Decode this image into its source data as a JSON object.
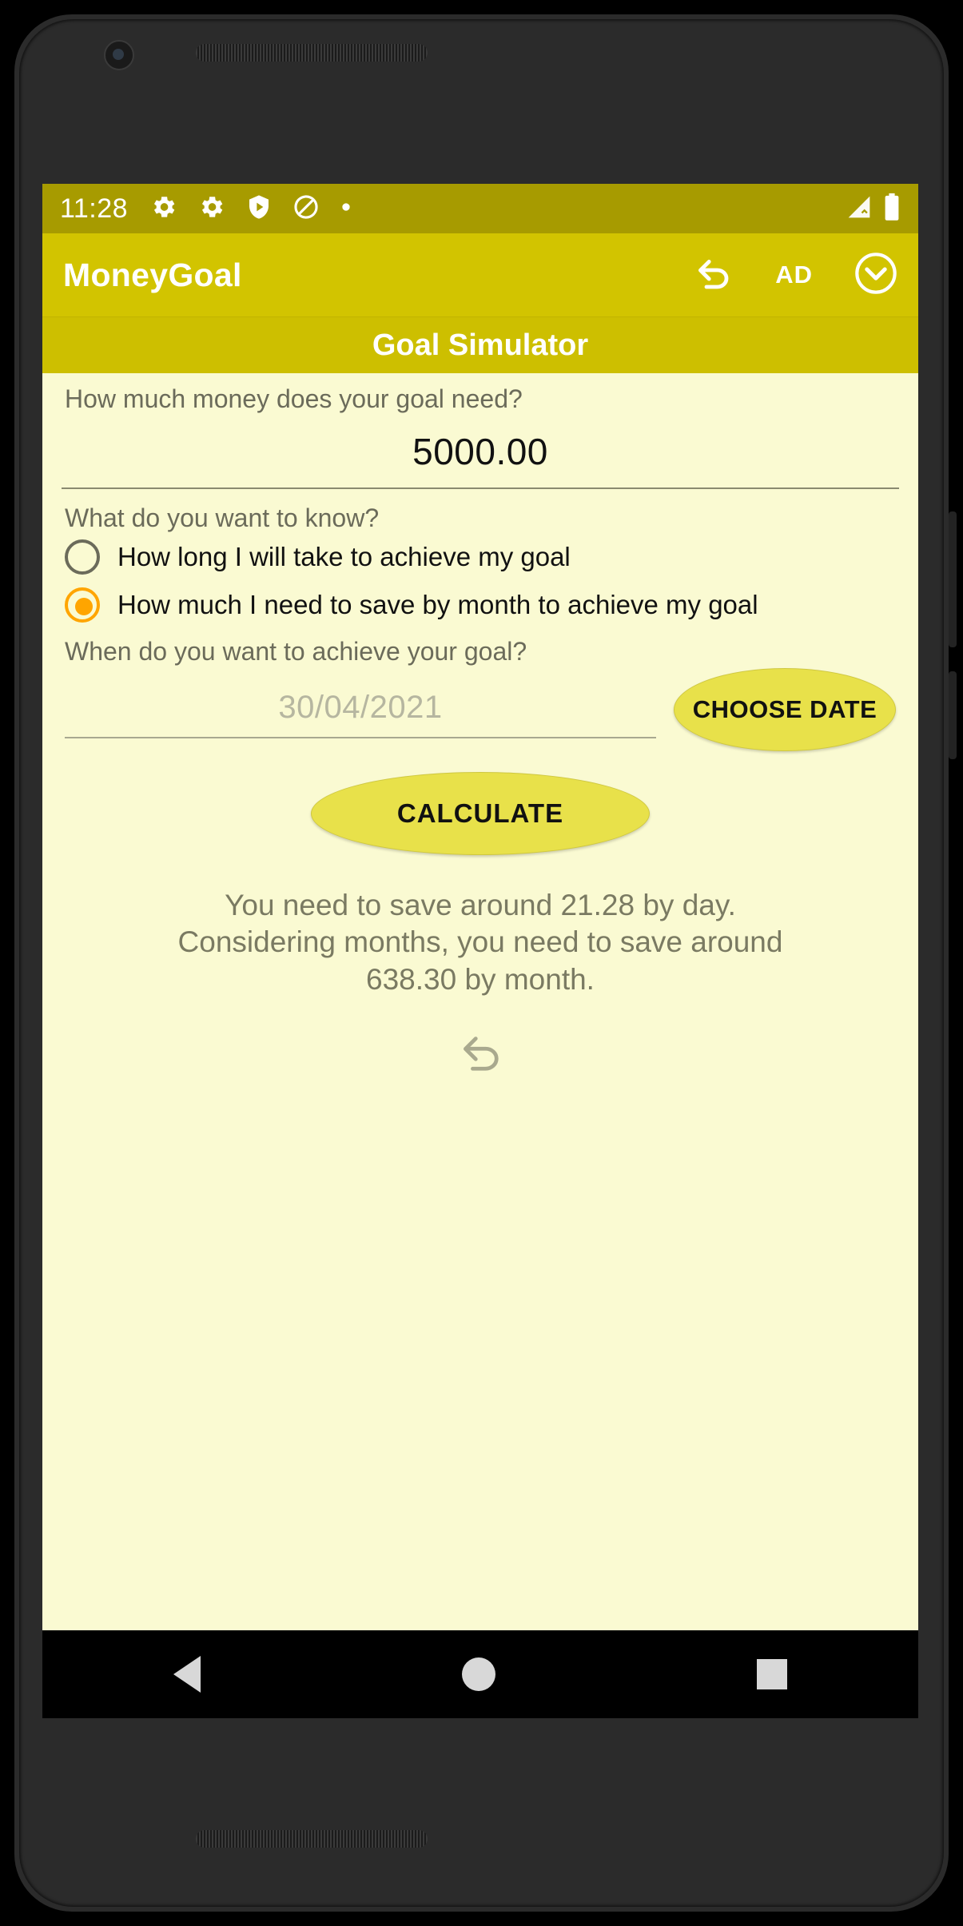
{
  "device": {
    "nav": {
      "back_label": "back-triangle",
      "home_label": "home-circle",
      "recents_label": "recents-square"
    }
  },
  "status_bar": {
    "time": "11:28",
    "icons": [
      "gear-icon",
      "gear-icon",
      "shield-play-icon",
      "circle-slash-icon",
      "dot-icon"
    ],
    "right_icons": [
      "signal-icon",
      "battery-icon"
    ],
    "background_color": "#A79B00"
  },
  "app_bar": {
    "title": "MoneyGoal",
    "ad_label": "AD",
    "undo_icon": "undo-arrow-icon",
    "dropdown_icon": "chevron-down-circle-icon",
    "background_color": "#D2C400"
  },
  "subtitle_bar": {
    "title": "Goal Simulator",
    "background_color": "#CDBF00"
  },
  "form": {
    "amount_question": "How much money does your goal need?",
    "amount_value": "5000.00",
    "know_question": "What do you want to know?",
    "options": [
      {
        "label": "How long I will take to achieve my goal",
        "selected": false
      },
      {
        "label": "How much I need to save by month to achieve my goal",
        "selected": true
      }
    ],
    "date_question": "When do you want to achieve your goal?",
    "date_placeholder": "30/04/2021",
    "choose_date_label": "CHOOSE DATE",
    "calculate_label": "CALCULATE"
  },
  "result": {
    "line1": "You need to save around 21.28 by day.",
    "line2": "Considering months, you need to save around",
    "line3": "638.30 by month.",
    "reset_icon": "undo-arrow-icon"
  },
  "colors": {
    "accent_radio": "#FFA500",
    "button_fill": "#E8E14A",
    "screen_background": "#FAFAD2",
    "result_text": "#7a7a62"
  }
}
